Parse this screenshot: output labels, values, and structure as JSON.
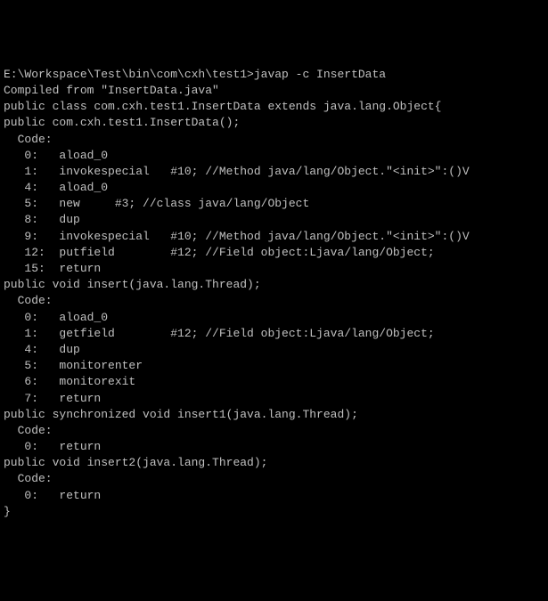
{
  "terminal": {
    "lines": [
      "E:\\Workspace\\Test\\bin\\com\\cxh\\test1>javap -c InsertData",
      "Compiled from \"InsertData.java\"",
      "public class com.cxh.test1.InsertData extends java.lang.Object{",
      "public com.cxh.test1.InsertData();",
      "  Code:",
      "   0:   aload_0",
      "   1:   invokespecial   #10; //Method java/lang/Object.\"<init>\":()V",
      "   4:   aload_0",
      "   5:   new     #3; //class java/lang/Object",
      "   8:   dup",
      "   9:   invokespecial   #10; //Method java/lang/Object.\"<init>\":()V",
      "   12:  putfield        #12; //Field object:Ljava/lang/Object;",
      "   15:  return",
      "",
      "public void insert(java.lang.Thread);",
      "  Code:",
      "   0:   aload_0",
      "   1:   getfield        #12; //Field object:Ljava/lang/Object;",
      "   4:   dup",
      "   5:   monitorenter",
      "   6:   monitorexit",
      "   7:   return",
      "",
      "public synchronized void insert1(java.lang.Thread);",
      "  Code:",
      "   0:   return",
      "",
      "public void insert2(java.lang.Thread);",
      "  Code:",
      "   0:   return",
      "",
      "}"
    ]
  }
}
